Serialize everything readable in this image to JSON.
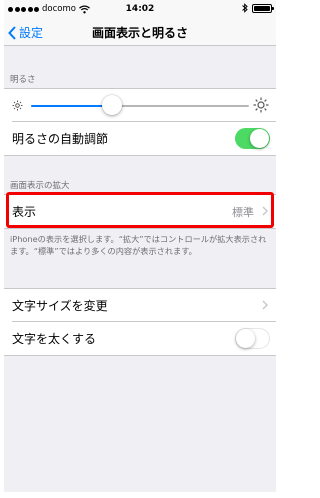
{
  "status_bar": {
    "carrier": "docomo",
    "time": "14:02"
  },
  "nav": {
    "back_label": "設定",
    "title": "画面表示と明るさ"
  },
  "brightness_section": {
    "header": "明るさ",
    "slider_level": 0.37,
    "auto_label": "明るさの自動調節",
    "auto_enabled": true
  },
  "zoom_section": {
    "header": "画面表示の拡大",
    "view_label": "表示",
    "view_value": "標準",
    "footer": "iPhoneの表示を選択します。“拡大”ではコントロールが拡大表示されます。“標準”ではより多くの内容が表示されます。"
  },
  "text_section": {
    "text_size_label": "文字サイズを変更",
    "bold_text_label": "文字を太くする",
    "bold_enabled": false
  },
  "colors": {
    "accent": "#007aff",
    "toggle_on": "#4cd964",
    "highlight": "#f20000",
    "background": "#efeff4"
  }
}
